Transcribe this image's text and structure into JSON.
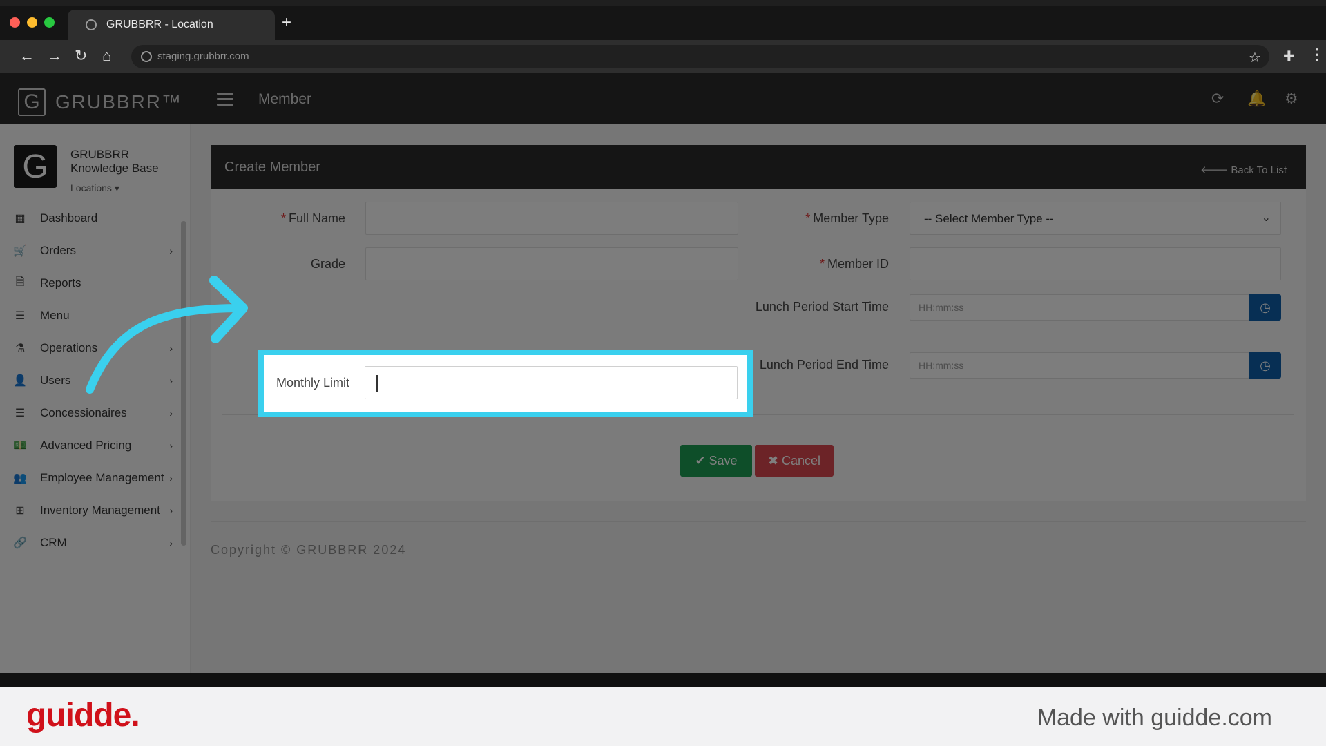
{
  "browser": {
    "tab_title": "GRUBBRR - Location",
    "new_tab": "+",
    "url": "staging.grubbrr.com",
    "nav": {
      "back": "←",
      "forward": "→",
      "reload": "↻",
      "home": "⌂"
    },
    "star": "☆",
    "extensions": "✚",
    "menu": "⋮"
  },
  "app": {
    "logo_letter": "G",
    "logo_text": "GRUBBRR™",
    "page_title": "Member"
  },
  "sidebar": {
    "brand_letter": "G",
    "brand_name": "GRUBBRR Knowledge Base",
    "locations": "Locations ▾",
    "items": [
      {
        "label": "Dashboard",
        "icon": "dashboard-icon",
        "glyph": "▦",
        "has_children": false
      },
      {
        "label": "Orders",
        "icon": "cart-icon",
        "glyph": "🛒",
        "has_children": true
      },
      {
        "label": "Reports",
        "icon": "file-icon",
        "glyph": "🗎",
        "has_children": false
      },
      {
        "label": "Menu",
        "icon": "list-icon",
        "glyph": "☰",
        "has_children": true
      },
      {
        "label": "Operations",
        "icon": "flask-icon",
        "glyph": "⚗",
        "has_children": true
      },
      {
        "label": "Users",
        "icon": "user-plus-icon",
        "glyph": "👤",
        "has_children": true
      },
      {
        "label": "Concessionaires",
        "icon": "list-icon",
        "glyph": "☰",
        "has_children": true
      },
      {
        "label": "Advanced Pricing",
        "icon": "money-icon",
        "glyph": "💵",
        "has_children": true
      },
      {
        "label": "Employee Management",
        "icon": "users-icon",
        "glyph": "👥",
        "has_children": true
      },
      {
        "label": "Inventory Management",
        "icon": "sitemap-icon",
        "glyph": "⊞",
        "has_children": true
      },
      {
        "label": "CRM",
        "icon": "link-icon",
        "glyph": "🔗",
        "has_children": true
      }
    ],
    "chevron": "›"
  },
  "form": {
    "title": "Create Member",
    "back_link": "🡐 Back To List",
    "required_mark": "*",
    "full_name_label": "Full Name",
    "grade_label": "Grade",
    "monthly_limit_label": "Monthly Limit",
    "member_type_label": "Member Type",
    "member_type_value": "-- Select Member Type --",
    "member_id_label": "Member ID",
    "lunch_start_label": "Lunch Period Start Time",
    "lunch_end_label": "Lunch Period End Time",
    "time_placeholder": "HH:mm:ss",
    "clock_glyph": "◷",
    "save_label": "✔ Save",
    "cancel_label": "✖ Cancel"
  },
  "copyright": "Copyright © GRUBBRR 2024",
  "footer": {
    "brand": "guidde.",
    "made_with": "Made with guidde.com"
  },
  "colors": {
    "highlight": "#3ad0ee",
    "save": "#1c9c52",
    "cancel": "#d9474f",
    "clock_button": "#0e5fa8",
    "guidde_red": "#d0111a"
  }
}
